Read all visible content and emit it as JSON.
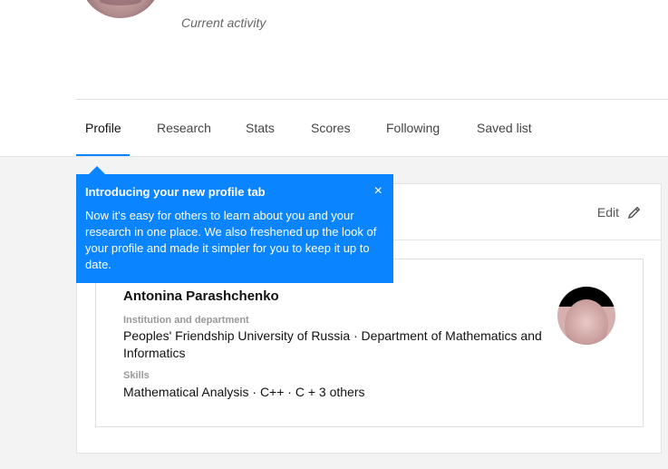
{
  "header": {
    "current_activity": "Current activity"
  },
  "tabs": [
    {
      "label": "Profile",
      "active": true
    },
    {
      "label": "Research",
      "active": false
    },
    {
      "label": "Stats",
      "active": false
    },
    {
      "label": "Scores",
      "active": false
    },
    {
      "label": "Following",
      "active": false
    },
    {
      "label": "Saved list",
      "active": false
    }
  ],
  "tooltip": {
    "title": "Introducing your new profile tab",
    "close_icon": "×",
    "body": "Now it's easy for others to learn about you and your research in one place. We also freshened up the look of your profile and made it simpler for you to keep it up to date."
  },
  "card": {
    "edit_label": "Edit",
    "profile": {
      "name": "Antonina Parashchenko",
      "institution_label": "Institution and department",
      "institution_value": "Peoples' Friendship University of Russia · Department of Mathematics and Informatics",
      "skills_label": "Skills",
      "skills_value": "Mathematical Analysis · C++ · C + 3 others"
    }
  },
  "colors": {
    "accent": "#0a84ff",
    "content_background": "#f3f3f3"
  },
  "icons": {
    "edit": "pencil-icon",
    "close": "close-icon"
  }
}
